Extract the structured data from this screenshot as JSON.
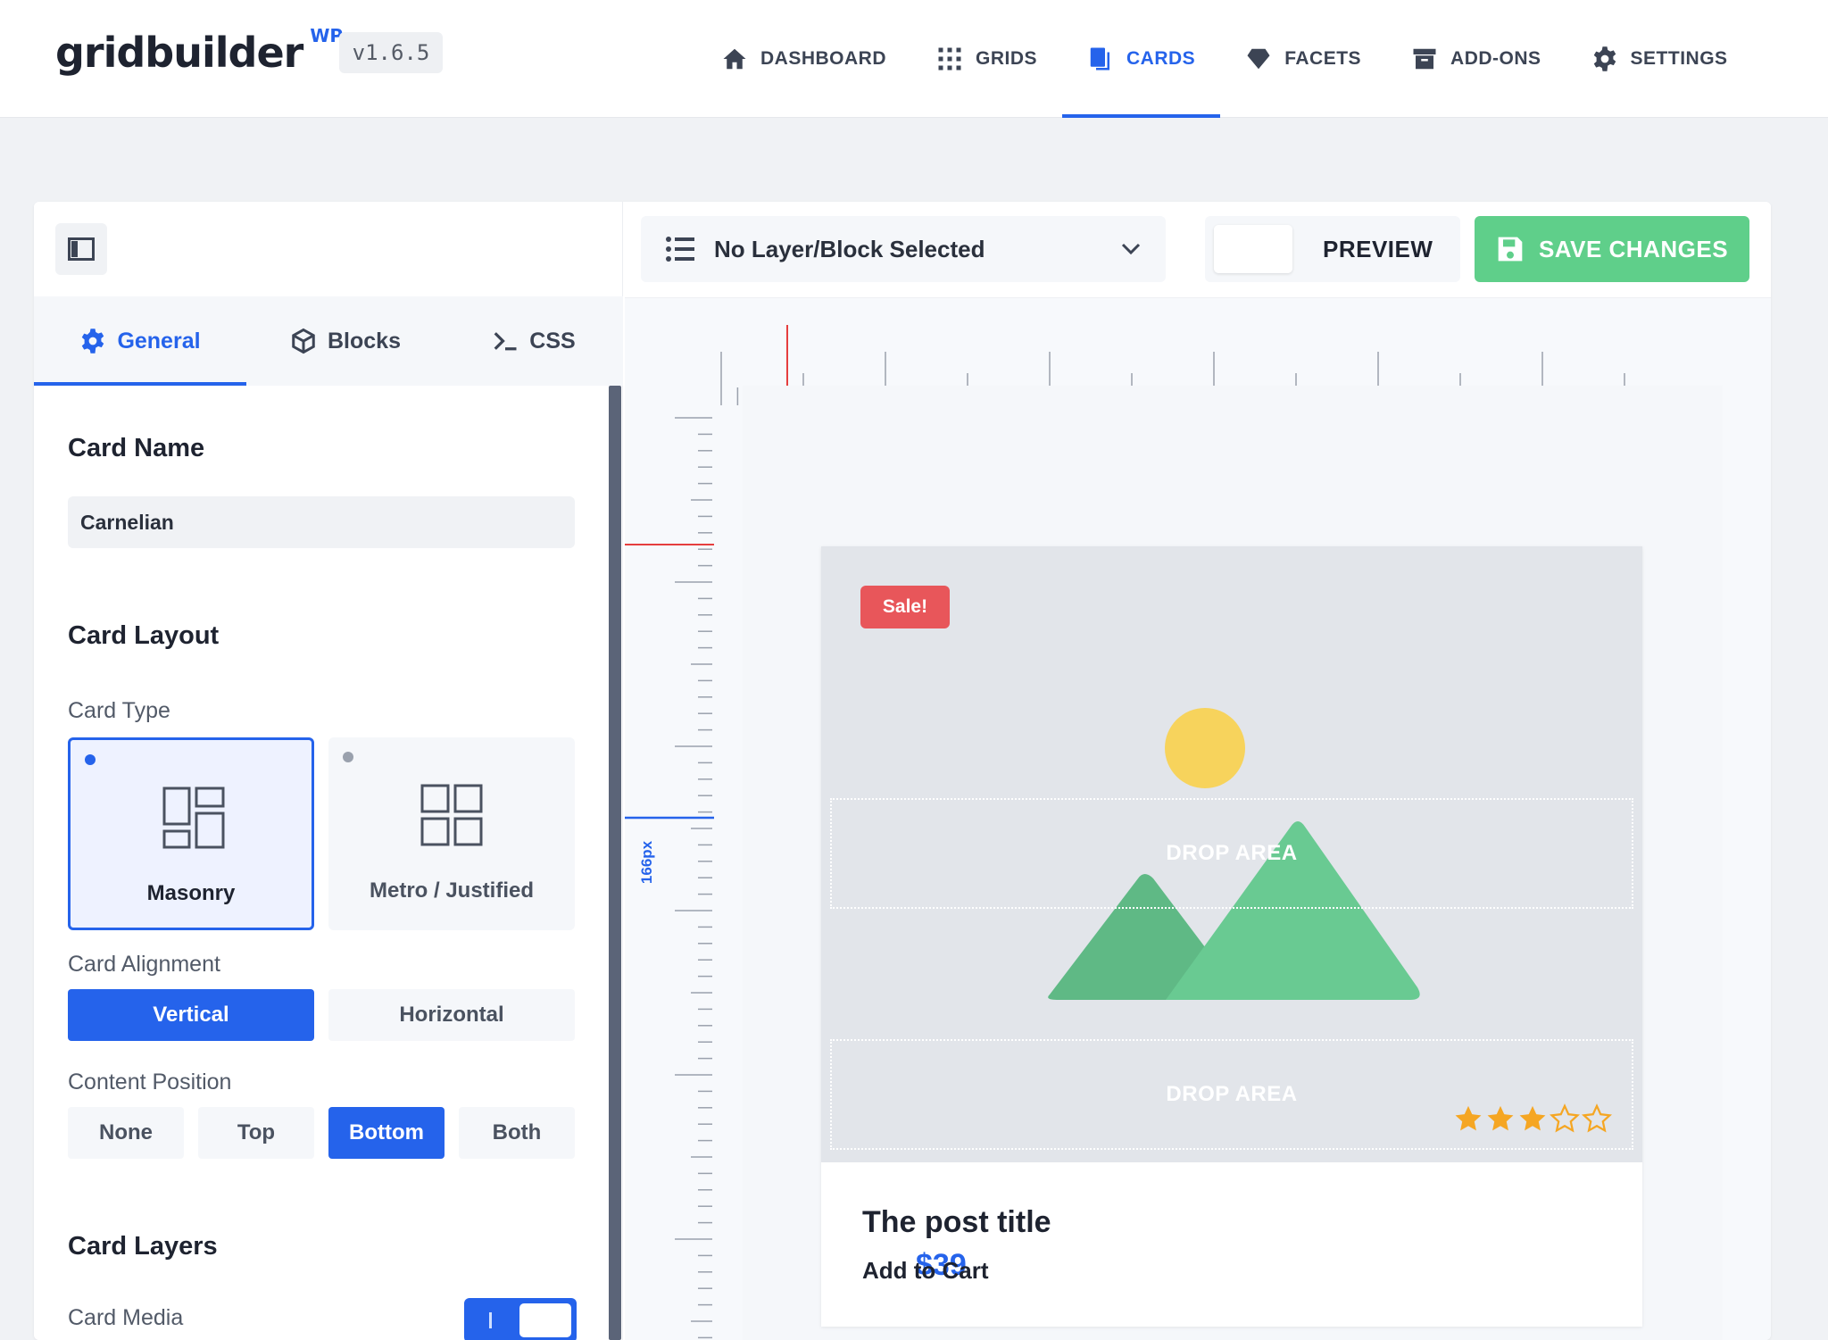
{
  "header": {
    "logo": "gridbuilder",
    "logo_sup": "WP",
    "version": "v1.6.5",
    "nav": [
      {
        "label": "DASHBOARD",
        "icon": "home-icon"
      },
      {
        "label": "GRIDS",
        "icon": "grid-icon"
      },
      {
        "label": "CARDS",
        "icon": "cards-icon",
        "active": true
      },
      {
        "label": "FACETS",
        "icon": "diamond-icon"
      },
      {
        "label": "ADD-ONS",
        "icon": "archive-icon"
      },
      {
        "label": "SETTINGS",
        "icon": "gear-icon"
      }
    ]
  },
  "sidebar": {
    "tabs": [
      {
        "label": "General",
        "icon": "gear-icon",
        "active": true
      },
      {
        "label": "Blocks",
        "icon": "cube-icon"
      },
      {
        "label": "CSS",
        "icon": "terminal-icon"
      }
    ],
    "card_name": {
      "title": "Card Name",
      "value": "Carnelian"
    },
    "card_layout": {
      "title": "Card Layout",
      "card_type_label": "Card Type",
      "card_types": [
        {
          "label": "Masonry",
          "selected": true
        },
        {
          "label": "Metro / Justified",
          "selected": false
        }
      ],
      "alignment_label": "Card Alignment",
      "alignments": [
        {
          "label": "Vertical",
          "active": true
        },
        {
          "label": "Horizontal",
          "active": false
        }
      ],
      "content_position_label": "Content Position",
      "content_positions": [
        {
          "label": "None",
          "active": false
        },
        {
          "label": "Top",
          "active": false
        },
        {
          "label": "Bottom",
          "active": true
        },
        {
          "label": "Both",
          "active": false
        }
      ]
    },
    "card_layers": {
      "title": "Card Layers",
      "card_media_label": "Card Media",
      "card_media_on": true
    }
  },
  "toolbar": {
    "layer_select": "No Layer/Block Selected",
    "preview_label": "PREVIEW",
    "save_label": "SAVE CHANGES"
  },
  "canvas": {
    "ruler_label": "166px",
    "card": {
      "badge": "Sale!",
      "drop_area_top": "DROP AREA",
      "drop_area_bottom": "DROP AREA",
      "rating": 3,
      "rating_max": 5,
      "title": "The post title",
      "cart_label": "Add to Cart",
      "price": "$39"
    }
  },
  "colors": {
    "accent": "#2563eb",
    "save": "#5fcf8a",
    "sale": "#e8565a",
    "star": "#f5a623",
    "ruler_marker": "#e53e3e"
  }
}
